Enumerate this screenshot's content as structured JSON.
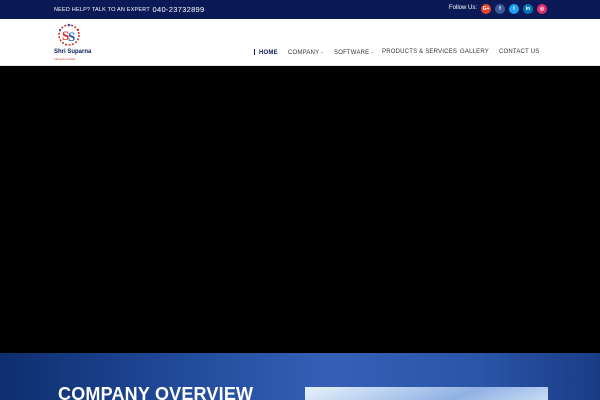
{
  "topbar": {
    "help_text": "NEED HELP? TALK TO AN EXPERT",
    "phone": "040-23732899",
    "follow_label": "Follow Us:",
    "social": [
      {
        "icon": "google-plus-icon",
        "glyph": "G+",
        "color": "#e8412c"
      },
      {
        "icon": "facebook-icon",
        "glyph": "f",
        "color": "#3b5998"
      },
      {
        "icon": "twitter-icon",
        "glyph": "t",
        "color": "#1da1f2"
      },
      {
        "icon": "linkedin-icon",
        "glyph": "in",
        "color": "#0077b5"
      },
      {
        "icon": "instagram-icon",
        "glyph": "◎",
        "color": "#e1306c"
      }
    ]
  },
  "logo": {
    "name": "Shri Suparna",
    "tagline": "Infotech Limited"
  },
  "nav": {
    "items": [
      {
        "label": "HOME",
        "active": true
      },
      {
        "label": "COMPANY",
        "dropdown": true
      },
      {
        "label": "SOFTWARE",
        "dropdown": true
      },
      {
        "label": "PRODUCTS & SERVICES"
      },
      {
        "label": "GALLERY"
      },
      {
        "label": "CONTACT US"
      }
    ]
  },
  "overview": {
    "title": "COMPANY OVERVIEW"
  },
  "colors": {
    "brand_navy": "#0b1a57",
    "accent_red": "#d0302b"
  }
}
